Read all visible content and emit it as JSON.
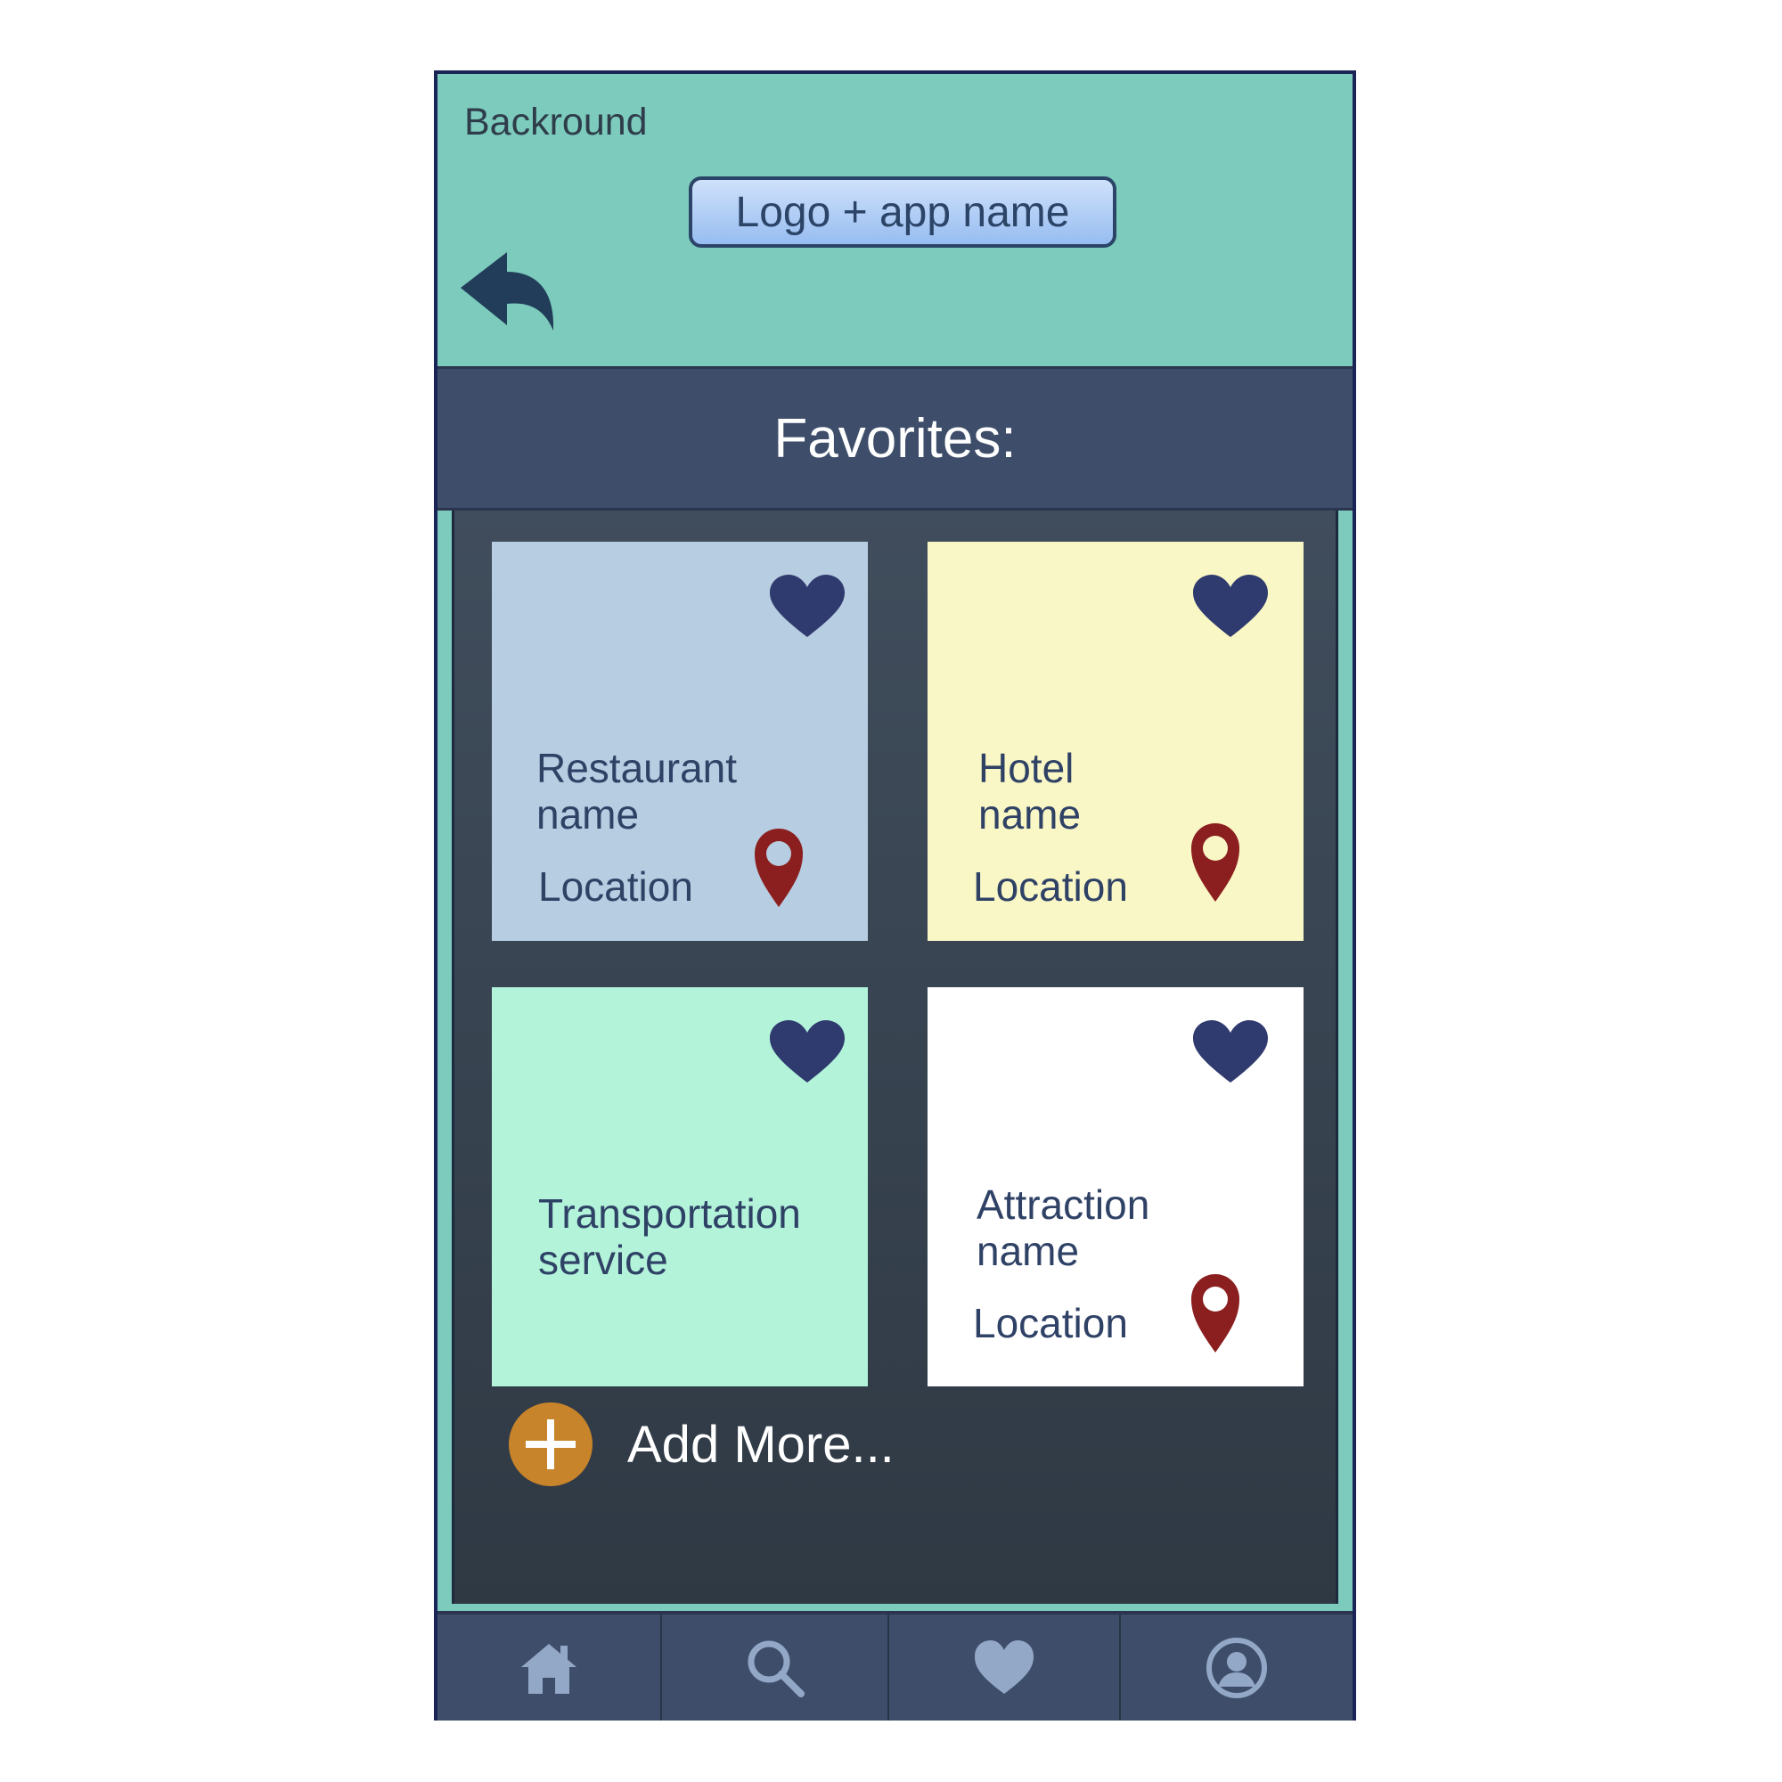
{
  "header": {
    "background_label": "Backround",
    "logo_label": "Logo + app name"
  },
  "favorites_title": "Favorites:",
  "cards": [
    {
      "title": "Restaurant\nname",
      "location": "Location",
      "color": "#b7cde1"
    },
    {
      "title": "Hotel\nname",
      "location": "Location",
      "color": "#faf7c6"
    },
    {
      "title": "Transportation\nservice",
      "location": "",
      "color": "#b2f3da"
    },
    {
      "title": "Attraction\nname",
      "location": "Location",
      "color": "#ffffff"
    }
  ],
  "add_more_label": "Add More...",
  "nav": [
    "home-icon",
    "search-icon",
    "heart-icon",
    "profile-icon"
  ],
  "colors": {
    "header_bg": "#7ccbbd",
    "bar_bg": "#3e4e6a",
    "heart": "#2f3a6e",
    "pin": "#8b1e1e",
    "add_button": "#c8842a",
    "nav_icon": "#93a8c7"
  }
}
